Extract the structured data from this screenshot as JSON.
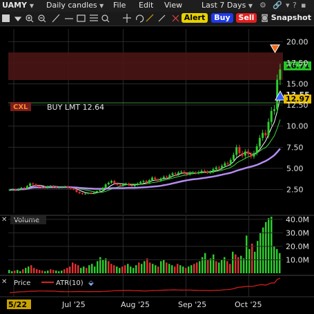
{
  "menu": {
    "symbol": "UAMY",
    "period": "Daily candles",
    "file": "File",
    "edit": "Edit",
    "view": "View",
    "range": "Last 7 Days"
  },
  "toolbar": {
    "alert": "Alert",
    "buy": "Buy",
    "sell": "Sell",
    "snapshot": "Snapshot"
  },
  "order": {
    "cancel_label": "CXL",
    "text": "BUY LMT 12.64",
    "price_tag": "12.97"
  },
  "price_tags": {
    "last": "16.71",
    "other": "13.55"
  },
  "panels": {
    "volume_title": "Volume",
    "price_title": "Price",
    "atr_title": "ATR(10)"
  },
  "colors": {
    "up": "#2ecc2e",
    "down": "#e03030",
    "ma_fast": "#ffffff",
    "ma_mid": "#3ddc3d",
    "ma_slow": "#b58cf0",
    "atr": "#e02020",
    "last_tag": "#22cc22",
    "order_tag": "#e5b800",
    "band": "#4a1212"
  },
  "chart_data": {
    "type": "candlestick",
    "y_ticks": [
      "20.00",
      "17.50",
      "15.00",
      "12.50",
      "10.00",
      "7.50",
      "5.00",
      "2.50"
    ],
    "ylim": [
      0.5,
      21.5
    ],
    "x_ticks": [
      "5/22",
      "Jul '25",
      "Aug '25",
      "Sep '25",
      "Oct '25"
    ],
    "volume_ticks": [
      "40.0M",
      "30.0M",
      "20.0M",
      "10.0M"
    ],
    "volume_ylim": [
      0,
      42
    ],
    "closes": [
      2.45,
      2.5,
      2.4,
      2.55,
      2.7,
      2.6,
      2.9,
      3.2,
      3.1,
      2.95,
      2.8,
      2.75,
      2.7,
      2.85,
      2.9,
      2.8,
      2.7,
      2.75,
      2.8,
      2.85,
      2.7,
      2.6,
      2.5,
      2.2,
      2.05,
      1.95,
      2.0,
      2.1,
      2.0,
      2.15,
      2.3,
      2.4,
      2.7,
      3.1,
      3.3,
      3.5,
      3.2,
      3.05,
      2.95,
      3.1,
      3.2,
      3.0,
      2.9,
      3.05,
      3.2,
      3.4,
      3.5,
      3.3,
      3.6,
      3.9,
      3.7,
      3.55,
      3.8,
      4.0,
      3.9,
      4.2,
      4.4,
      4.3,
      4.5,
      4.6,
      4.4,
      4.3,
      4.5,
      4.5,
      4.45,
      4.55,
      4.7,
      4.6,
      4.5,
      4.6,
      4.9,
      5.1,
      5.0,
      5.3,
      5.6,
      5.5,
      6.0,
      6.6,
      7.5,
      6.8,
      6.5,
      7.0,
      6.7,
      6.4,
      6.8,
      7.6,
      8.6,
      9.2,
      8.9,
      10.5,
      11.8,
      12.0,
      15.5,
      16.71
    ],
    "volume_values": [
      2.5,
      1.5,
      2,
      2.5,
      1.5,
      3,
      4,
      5,
      6,
      4,
      3,
      2.5,
      2,
      1.5,
      2,
      3,
      2.5,
      2,
      1.5,
      2,
      3,
      4,
      5,
      8,
      7,
      6,
      4,
      5,
      4,
      6,
      7,
      5,
      9,
      12,
      10,
      11,
      9,
      7,
      6,
      5,
      4,
      5,
      6,
      7,
      5,
      4,
      6,
      8,
      7,
      9,
      11,
      8,
      7,
      6,
      5,
      9,
      10,
      8,
      7,
      6,
      5,
      7,
      6,
      5,
      4,
      5,
      6,
      7,
      8,
      9,
      12,
      15,
      10,
      11,
      14,
      9,
      8,
      10,
      12,
      9,
      7,
      16,
      14,
      12,
      13,
      11,
      28,
      18,
      22,
      16,
      24,
      30,
      34,
      38,
      41,
      42,
      20,
      18,
      15
    ]
  }
}
